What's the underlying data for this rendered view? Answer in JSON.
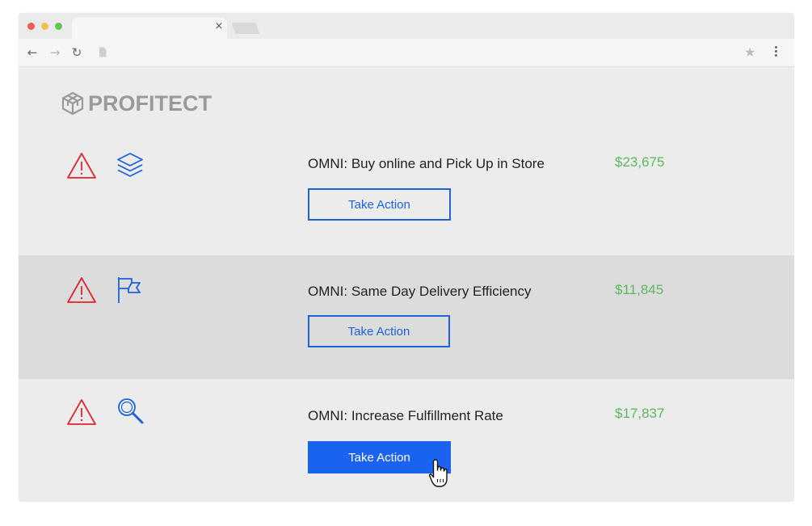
{
  "browser": {
    "close_glyph": "×",
    "back_glyph": "←",
    "forward_glyph": "→",
    "reload_glyph": "↻",
    "star_glyph": "★",
    "traffic_lights": [
      "#ed5c57",
      "#f5bf4f",
      "#62c554"
    ]
  },
  "logo": {
    "text": "PROFITECT"
  },
  "colors": {
    "accent": "#1a63ee",
    "warning": "#e0262a",
    "amount": "#5cb85c",
    "icon_blue": "#1a63d8"
  },
  "items": [
    {
      "title": "OMNI: Buy online and Pick Up in Store",
      "amount": "$23,675",
      "action_label": "Take Action",
      "category_icon": "layers-icon"
    },
    {
      "title": "OMNI: Same Day Delivery Efficiency",
      "amount": "$11,845",
      "action_label": "Take Action",
      "category_icon": "flag-icon"
    },
    {
      "title": "OMNI: Increase Fulfillment Rate",
      "amount": "$17,837",
      "action_label": "Take Action",
      "category_icon": "magnifier-icon"
    }
  ]
}
